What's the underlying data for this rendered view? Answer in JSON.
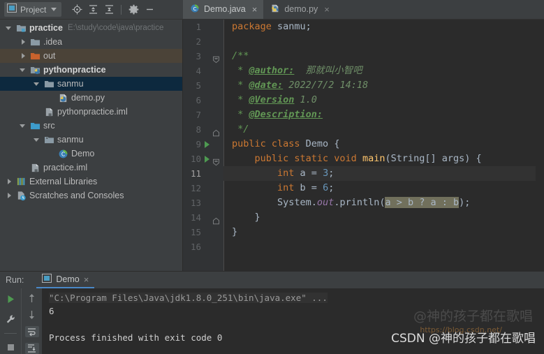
{
  "project_toolbar": {
    "label": "Project",
    "icons": [
      "project-window-icon",
      "caret-down-icon",
      "locate-icon",
      "expand-all-icon",
      "collapse-all-icon",
      "gear-icon",
      "minimize-icon"
    ]
  },
  "editor_tabs": [
    {
      "label": "Demo.java",
      "icon": "java-class-icon",
      "active": true,
      "close": "×"
    },
    {
      "label": "demo.py",
      "icon": "python-file-icon",
      "active": false,
      "close": "×"
    }
  ],
  "project_tree": [
    {
      "label": "practice",
      "path": "E:\\study\\code\\java\\practice",
      "indent": 0,
      "arrow": "down",
      "icon": "module-folder-icon",
      "bold": true,
      "sel": "none"
    },
    {
      "label": ".idea",
      "path": "",
      "indent": 1,
      "arrow": "right",
      "icon": "folder-icon",
      "bold": false,
      "sel": "none"
    },
    {
      "label": "out",
      "path": "",
      "indent": 1,
      "arrow": "right",
      "icon": "out-folder-icon",
      "bold": false,
      "sel": "brown"
    },
    {
      "label": "pythonpractice",
      "path": "",
      "indent": 1,
      "arrow": "down",
      "icon": "python-module-icon",
      "bold": true,
      "sel": "none"
    },
    {
      "label": "sanmu",
      "path": "",
      "indent": 2,
      "arrow": "down",
      "icon": "folder-icon",
      "bold": false,
      "sel": "blue"
    },
    {
      "label": "demo.py",
      "path": "",
      "indent": 3,
      "arrow": "blank",
      "icon": "python-file-icon",
      "bold": false,
      "sel": "none"
    },
    {
      "label": "pythonpractice.iml",
      "path": "",
      "indent": 2,
      "arrow": "blank",
      "icon": "iml-file-icon",
      "bold": false,
      "sel": "none"
    },
    {
      "label": "src",
      "path": "",
      "indent": 1,
      "arrow": "down",
      "icon": "source-folder-icon",
      "bold": false,
      "sel": "none"
    },
    {
      "label": "sanmu",
      "path": "",
      "indent": 2,
      "arrow": "down",
      "icon": "package-icon",
      "bold": false,
      "sel": "none"
    },
    {
      "label": "Demo",
      "path": "",
      "indent": 3,
      "arrow": "blank",
      "icon": "java-class-icon",
      "bold": false,
      "sel": "none"
    },
    {
      "label": "practice.iml",
      "path": "",
      "indent": 1,
      "arrow": "blank",
      "icon": "iml-file-icon",
      "bold": false,
      "sel": "none"
    },
    {
      "label": "External Libraries",
      "path": "",
      "indent": 0,
      "arrow": "right",
      "icon": "libraries-icon",
      "bold": false,
      "sel": "none"
    },
    {
      "label": "Scratches and Consoles",
      "path": "",
      "indent": 0,
      "arrow": "right",
      "icon": "scratches-icon",
      "bold": false,
      "sel": "none"
    }
  ],
  "editor": {
    "current_line": 11,
    "lines": [
      {
        "n": 1,
        "run": false
      },
      {
        "n": 2,
        "run": false
      },
      {
        "n": 3,
        "run": false
      },
      {
        "n": 4,
        "run": false
      },
      {
        "n": 5,
        "run": false
      },
      {
        "n": 6,
        "run": false
      },
      {
        "n": 7,
        "run": false
      },
      {
        "n": 8,
        "run": false
      },
      {
        "n": 9,
        "run": true
      },
      {
        "n": 10,
        "run": true
      },
      {
        "n": 11,
        "run": false
      },
      {
        "n": 12,
        "run": false
      },
      {
        "n": 13,
        "run": false
      },
      {
        "n": 14,
        "run": false
      },
      {
        "n": 15,
        "run": false
      },
      {
        "n": 16,
        "run": false
      }
    ],
    "code": {
      "l1_kw": "package",
      "l1_rest": " sanmu;",
      "l3": "/**",
      "l4_star": " * ",
      "l4_tag": "@author:",
      "l4_val": "  那就叫小智吧",
      "l5_star": " * ",
      "l5_tag": "@date:",
      "l5_val": " 2022/7/2 14:18",
      "l6_star": " * ",
      "l6_tag": "@Version",
      "l6_val": " 1.0",
      "l7_star": " * ",
      "l7_tag": "@Description:",
      "l7_val": "",
      "l8": " */",
      "l9_kw": "public class ",
      "l9_name": "Demo",
      "l9_brace": " {",
      "l10_kw": "    public static void ",
      "l10_fn": "main",
      "l10_args": "(String[] args) {",
      "l11_kw": "        int ",
      "l11_var": "a = ",
      "l11_num": "3",
      "l11_end": ";",
      "l12_kw": "        int ",
      "l12_var": "b = ",
      "l12_num": "6",
      "l12_end": ";",
      "l13_pre": "        System.",
      "l13_fld": "out",
      "l13_mid": ".println(",
      "l13_hl": "a > b ? a : b",
      "l13_end": ");",
      "l14": "    }",
      "l15": "}",
      "l16": ""
    }
  },
  "run_panel": {
    "run_label": "Run:",
    "tab_label": "Demo",
    "tab_close": "×",
    "gutter_icons": [
      "rerun-icon",
      "settings-wrench-icon",
      "stop-icon",
      "scroll-up-icon",
      "scroll-down-icon",
      "soft-wrap-icon",
      "scroll-to-end-icon"
    ],
    "console_lines": [
      {
        "text": "\"C:\\Program Files\\Java\\jdk1.8.0_251\\bin\\java.exe\" ...",
        "style": "cmd"
      },
      {
        "text": "6",
        "style": "out"
      },
      {
        "text": "",
        "style": "out"
      },
      {
        "text": "Process finished with exit code 0",
        "style": "out"
      }
    ]
  },
  "watermarks": {
    "faint": "@神的孩子都在歌唱",
    "orange": "https://blog.csdn.net/",
    "main": "CSDN @神的孩子都在歌唱"
  }
}
